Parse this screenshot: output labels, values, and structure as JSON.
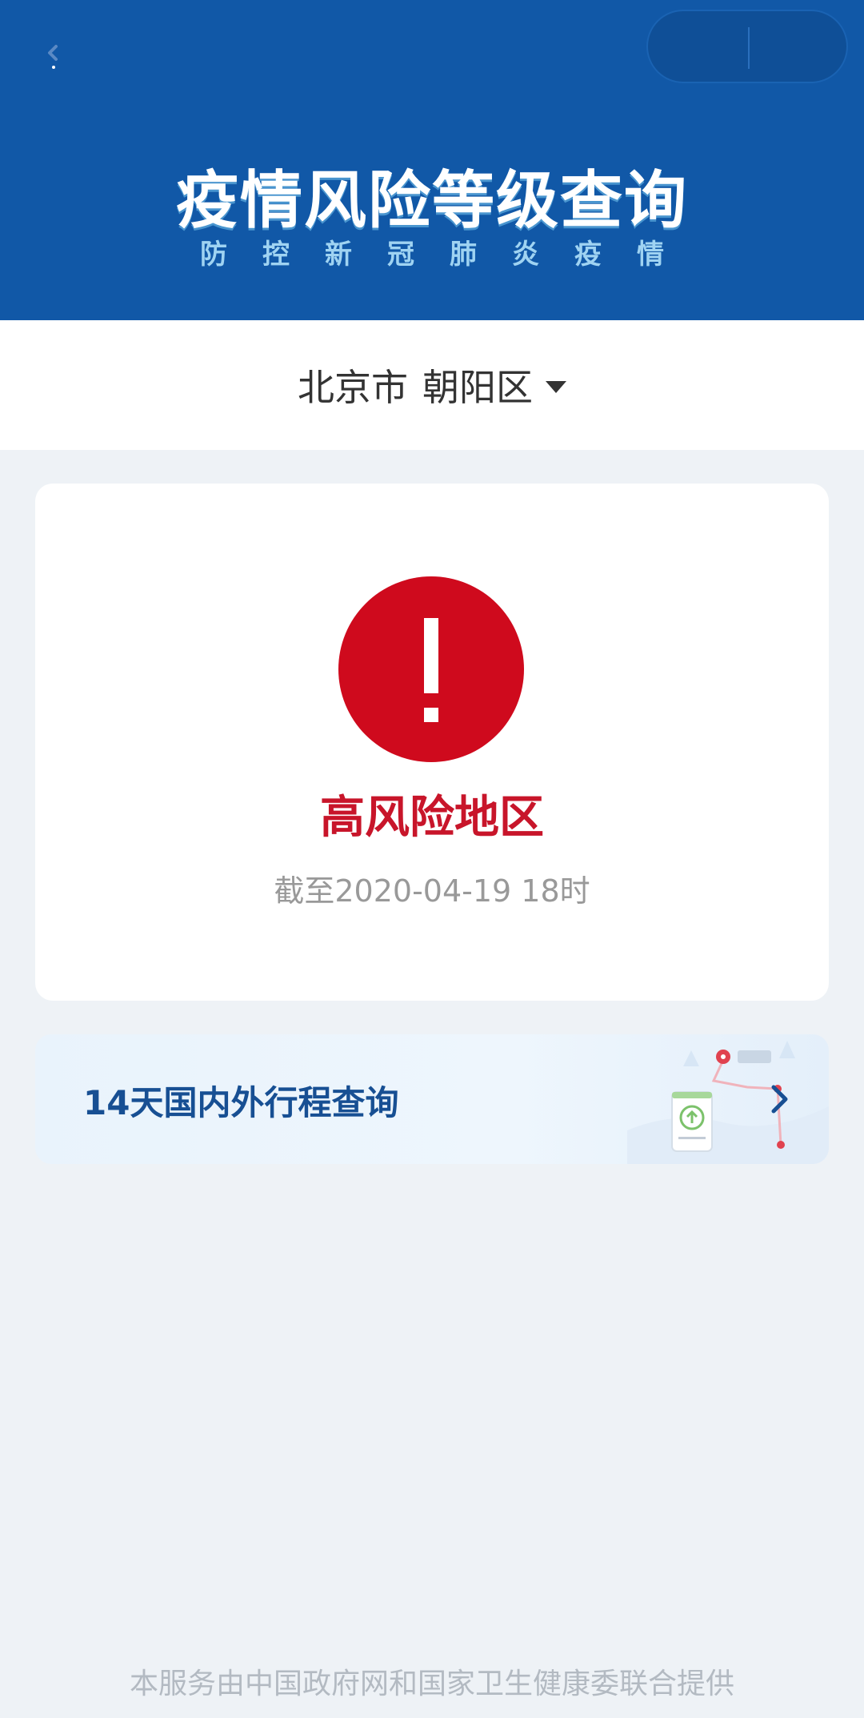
{
  "header": {
    "title": "疫情风险等级查询",
    "subtitle": "防控新冠肺炎疫情"
  },
  "location": {
    "city": "北京市",
    "district": "朝阳区"
  },
  "risk": {
    "level": "高风险地区",
    "update_time": "截至2020-04-19 18时"
  },
  "trip": {
    "label": "14天国内外行程查询"
  },
  "footer": {
    "text": "本服务由中国政府网和国家卫生健康委联合提供"
  },
  "colors": {
    "header_bg": "#1158a7",
    "alert_red": "#cf0a1d",
    "risk_text": "#c8152a",
    "trip_text": "#174f93"
  }
}
